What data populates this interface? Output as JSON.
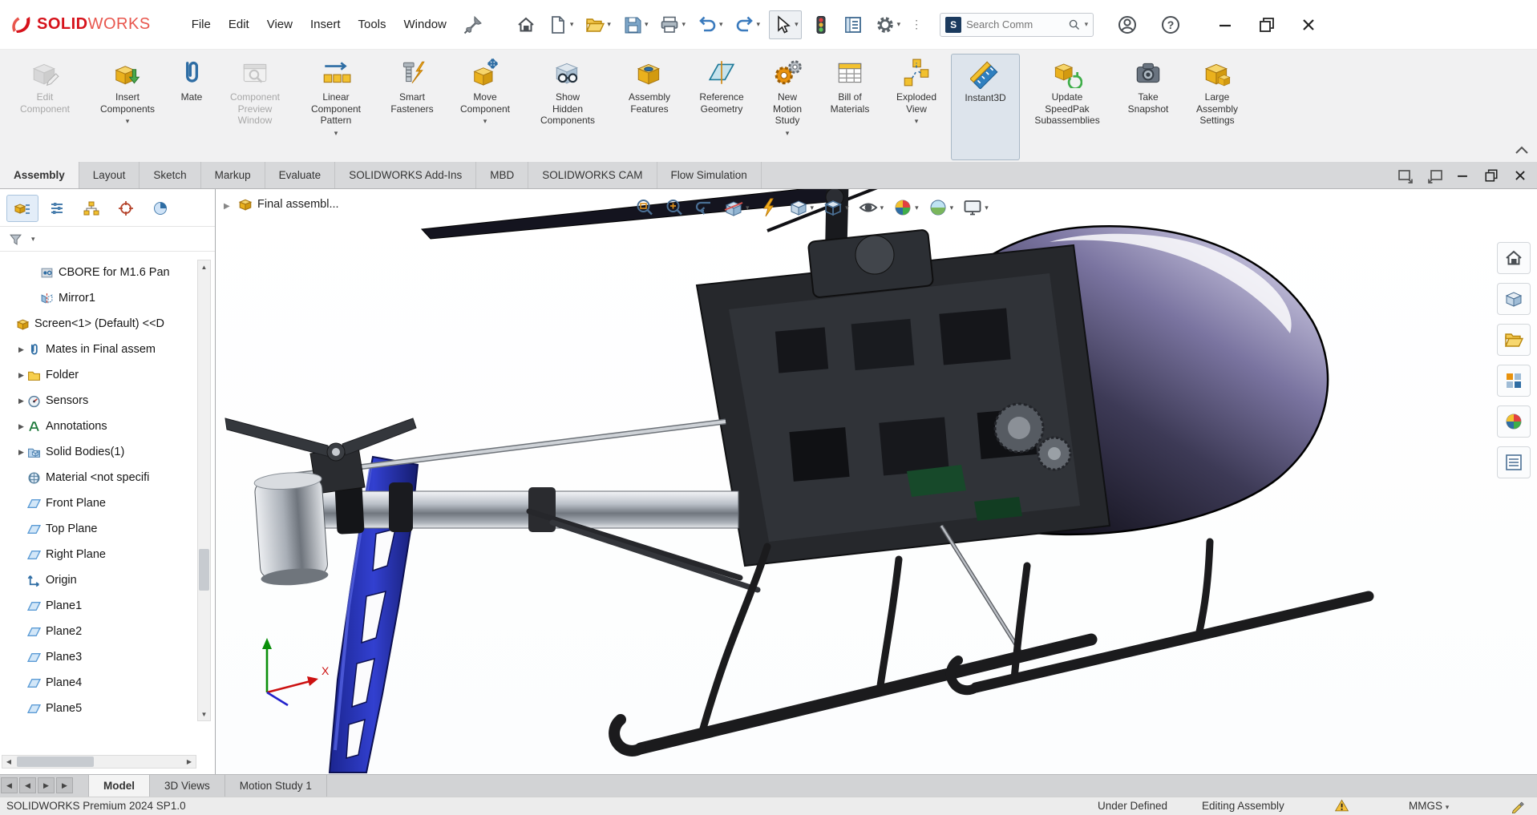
{
  "titlebar": {
    "brand": {
      "solid": "SOLID",
      "works": "WORKS"
    },
    "menus": [
      "File",
      "Edit",
      "View",
      "Insert",
      "Tools",
      "Window"
    ],
    "tool_icons": [
      "pin",
      "home",
      "new-document",
      "open",
      "save",
      "print",
      "undo",
      "redo",
      "select-cursor",
      "traffic-light",
      "task-sheet",
      "options-gear",
      "overflow"
    ],
    "search": {
      "placeholder": "Search Comm"
    },
    "right_icons": [
      "user-account",
      "help",
      "minimize",
      "restore",
      "close"
    ]
  },
  "ribbon": {
    "buttons": [
      {
        "label": "Edit\nComponent",
        "state": "disabled",
        "dropdown": false
      },
      {
        "label": "Insert\nComponents",
        "state": "normal",
        "dropdown": true
      },
      {
        "label": "Mate",
        "state": "normal",
        "dropdown": false
      },
      {
        "label": "Component\nPreview\nWindow",
        "state": "disabled",
        "dropdown": false
      },
      {
        "label": "Linear\nComponent\nPattern",
        "state": "normal",
        "dropdown": true
      },
      {
        "label": "Smart\nFasteners",
        "state": "normal",
        "dropdown": false
      },
      {
        "label": "Move\nComponent",
        "state": "normal",
        "dropdown": true
      },
      {
        "label": "Show\nHidden\nComponents",
        "state": "normal",
        "dropdown": false
      },
      {
        "label": "Assembly\nFeatures",
        "state": "normal",
        "dropdown": false
      },
      {
        "label": "Reference\nGeometry",
        "state": "normal",
        "dropdown": false
      },
      {
        "label": "New\nMotion\nStudy",
        "state": "normal",
        "dropdown": true
      },
      {
        "label": "Bill of\nMaterials",
        "state": "normal",
        "dropdown": false
      },
      {
        "label": "Exploded\nView",
        "state": "normal",
        "dropdown": true
      },
      {
        "label": "Instant3D",
        "state": "active",
        "dropdown": false
      },
      {
        "label": "Update\nSpeedPak\nSubassemblies",
        "state": "normal",
        "dropdown": false
      },
      {
        "label": "Take\nSnapshot",
        "state": "normal",
        "dropdown": false
      },
      {
        "label": "Large\nAssembly\nSettings",
        "state": "normal",
        "dropdown": false
      }
    ]
  },
  "command_tabs": {
    "items": [
      {
        "label": "Assembly",
        "active": true
      },
      {
        "label": "Layout",
        "active": false
      },
      {
        "label": "Sketch",
        "active": false
      },
      {
        "label": "Markup",
        "active": false
      },
      {
        "label": "Evaluate",
        "active": false
      },
      {
        "label": "SOLIDWORKS Add-Ins",
        "active": false
      },
      {
        "label": "MBD",
        "active": false
      },
      {
        "label": "SOLIDWORKS CAM",
        "active": false
      },
      {
        "label": "Flow Simulation",
        "active": false
      }
    ]
  },
  "feature_panel": {
    "tabs": [
      "featuremanager",
      "propertymanager",
      "configurationmanager",
      "dimxpertmanager",
      "displaymanager"
    ],
    "filter_icon": "filter-funnel",
    "items": [
      {
        "label": "CBORE for M1.6 Pan",
        "icon": "hole-wizard",
        "indent": 2,
        "arrow": false
      },
      {
        "label": "Mirror1",
        "icon": "mirror",
        "indent": 2,
        "arrow": false
      },
      {
        "label": "Screen<1> (Default) <<D",
        "icon": "part",
        "indent": 0,
        "arrow": false
      },
      {
        "label": "Mates in Final assem",
        "icon": "mates",
        "indent": 1,
        "arrow": true
      },
      {
        "label": "Folder",
        "icon": "folder",
        "indent": 1,
        "arrow": true
      },
      {
        "label": "Sensors",
        "icon": "sensors",
        "indent": 1,
        "arrow": true
      },
      {
        "label": "Annotations",
        "icon": "annotations",
        "indent": 1,
        "arrow": true
      },
      {
        "label": "Solid Bodies(1)",
        "icon": "solid-bodies",
        "indent": 1,
        "arrow": true
      },
      {
        "label": "Material <not specifi",
        "icon": "material",
        "indent": 1,
        "arrow": false
      },
      {
        "label": "Front Plane",
        "icon": "plane",
        "indent": 1,
        "arrow": false
      },
      {
        "label": "Top Plane",
        "icon": "plane",
        "indent": 1,
        "arrow": false
      },
      {
        "label": "Right Plane",
        "icon": "plane",
        "indent": 1,
        "arrow": false
      },
      {
        "label": "Origin",
        "icon": "origin",
        "indent": 1,
        "arrow": false
      },
      {
        "label": "Plane1",
        "icon": "plane",
        "indent": 1,
        "arrow": false
      },
      {
        "label": "Plane2",
        "icon": "plane",
        "indent": 1,
        "arrow": false
      },
      {
        "label": "Plane3",
        "icon": "plane",
        "indent": 1,
        "arrow": false
      },
      {
        "label": "Plane4",
        "icon": "plane",
        "indent": 1,
        "arrow": false
      },
      {
        "label": "Plane5",
        "icon": "plane",
        "indent": 1,
        "arrow": false
      }
    ]
  },
  "viewport": {
    "breadcrumb": "Final assembl...",
    "headsup_icons": [
      "zoom-to-fit",
      "zoom-to-area",
      "previous-view",
      "section-view",
      "3d-drawing-view",
      "view-orientation",
      "display-style",
      "hide-show-items",
      "edit-appearance",
      "apply-scene",
      "view-settings"
    ],
    "task_pane_icons": [
      "solidworks-resources",
      "design-library",
      "file-explorer",
      "view-palette",
      "appearances-scenes",
      "custom-properties"
    ],
    "triad": {
      "x_label": "X"
    }
  },
  "document_tabs": {
    "items": [
      {
        "label": "Model",
        "active": true
      },
      {
        "label": "3D Views",
        "active": false
      },
      {
        "label": "Motion Study 1",
        "active": false
      }
    ]
  },
  "statusbar": {
    "product": "SOLIDWORKS Premium 2024 SP1.0",
    "constraint_state": "Under Defined",
    "mode": "Editing Assembly",
    "units": "MMGS"
  },
  "colors": {
    "brand_red": "#d6121b",
    "ribbon_bg": "#f1f1f2",
    "active_tool_highlight": "#dde4ec",
    "tail_fin_blue": "#2a35b8"
  }
}
